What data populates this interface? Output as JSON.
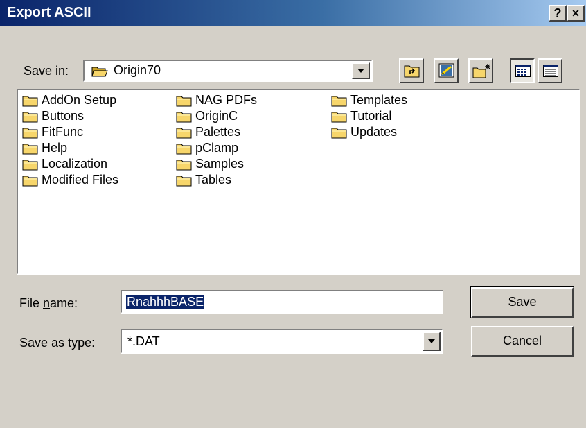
{
  "window": {
    "title": "Export ASCII",
    "help_button": "?",
    "close_button": "×"
  },
  "save_in": {
    "label_pre": "Save ",
    "label_accel": "i",
    "label_post": "n:",
    "value": "Origin70"
  },
  "toolbar": {
    "up_folder_icon": "up-one-level-icon",
    "desktop_icon": "desktop-icon",
    "new_folder_icon": "create-new-folder-icon",
    "list_view_icon": "list-view-icon",
    "details_view_icon": "details-view-icon"
  },
  "files": {
    "col1": [
      "AddOn Setup",
      "Buttons",
      "FitFunc",
      "Help",
      "Localization",
      "Modified Files"
    ],
    "col2": [
      "NAG PDFs",
      "OriginC",
      "Palettes",
      "pClamp",
      "Samples",
      "Tables"
    ],
    "col3": [
      "Templates",
      "Tutorial",
      "Updates"
    ]
  },
  "file_name": {
    "label_pre": "File ",
    "label_accel": "n",
    "label_post": "ame:",
    "value": "RnahhhBASE"
  },
  "save_as_type": {
    "label_pre": "Save as ",
    "label_accel": "t",
    "label_post": "ype:",
    "value": "*.DAT"
  },
  "buttons": {
    "save_accel": "S",
    "save_rest": "ave",
    "cancel": "Cancel"
  },
  "colors": {
    "title_bar_start": "#0a246a",
    "title_bar_end": "#a6caf0",
    "dialog_face": "#d4d0c8",
    "selection": "#0a246a",
    "folder_yellow": "#f7d66b"
  }
}
